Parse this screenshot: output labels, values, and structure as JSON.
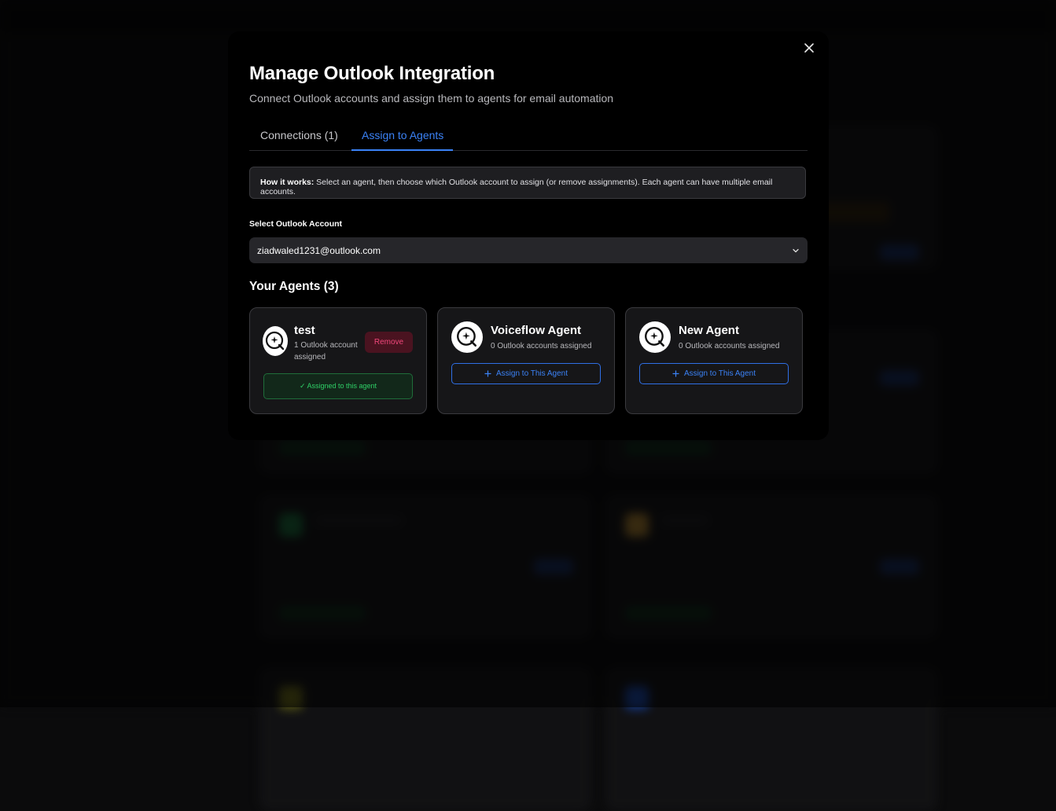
{
  "modal": {
    "title": "Manage Outlook Integration",
    "subtitle": "Connect Outlook accounts and assign them to agents for email automation",
    "close_icon": "close-icon"
  },
  "tabs": [
    {
      "label": "Connections (1)",
      "active": false
    },
    {
      "label": "Assign to Agents",
      "active": true
    }
  ],
  "info": {
    "bold": "How it works:",
    "text": " Select an agent, then choose which Outlook account to assign (or remove assignments). Each agent can have multiple email accounts."
  },
  "account_select": {
    "label": "Select Outlook Account",
    "value": "ziadwaled1231@outlook.com"
  },
  "agents_section": {
    "title": "Your Agents (3)"
  },
  "agents": [
    {
      "name": "test",
      "status": "1 Outlook account assigned",
      "remove_label": "Remove",
      "assigned_label": "✓ Assigned to this agent"
    },
    {
      "name": "Voiceflow Agent",
      "status": "0 Outlook accounts assigned",
      "assign_label": "Assign to This Agent"
    },
    {
      "name": "New Agent",
      "status": "0 Outlook accounts assigned",
      "assign_label": "Assign to This Agent"
    }
  ],
  "colors": {
    "accent": "#3b82f6",
    "success": "#2fd067",
    "danger": "#f0477a"
  }
}
